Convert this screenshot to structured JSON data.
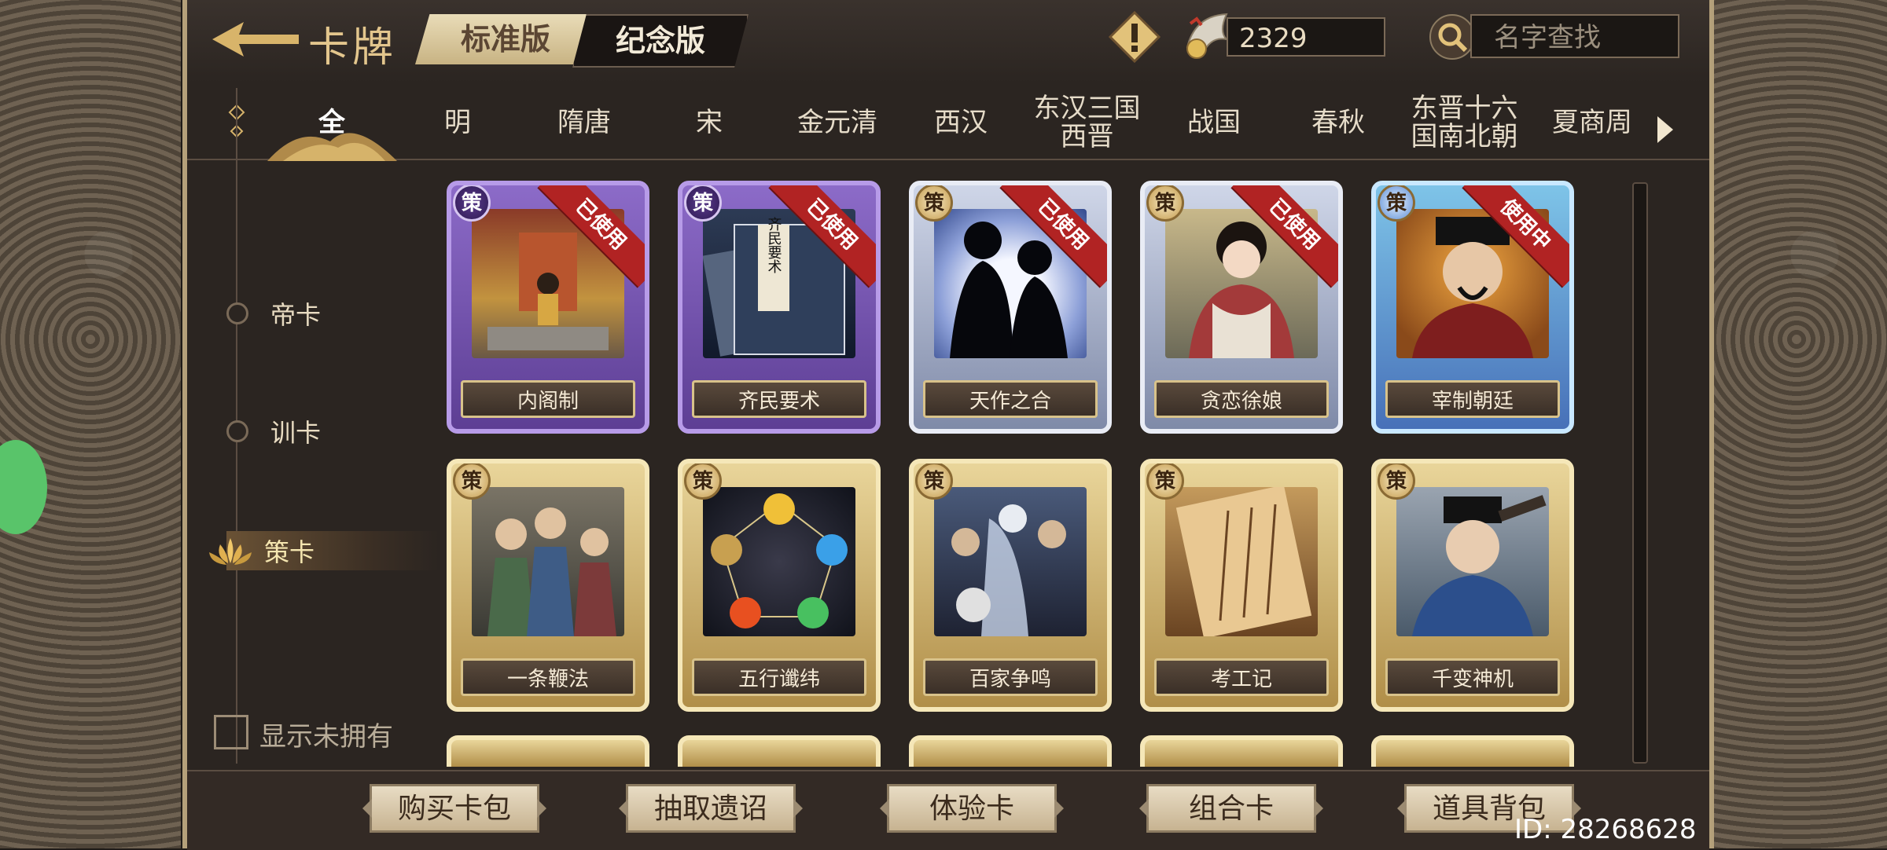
{
  "header": {
    "title": "卡牌",
    "version_tabs": [
      "标准版",
      "纪念版"
    ],
    "currency_value": "2329",
    "search_placeholder": "名字查找"
  },
  "era_tabs": [
    {
      "label": "全",
      "active": true
    },
    {
      "label": "明"
    },
    {
      "label": "隋唐"
    },
    {
      "label": "宋"
    },
    {
      "label": "金元清"
    },
    {
      "label": "西汉"
    },
    {
      "label": "东汉三国\n西晋"
    },
    {
      "label": "战国"
    },
    {
      "label": "春秋"
    },
    {
      "label": "东晋十六\n国南北朝"
    },
    {
      "label": "夏商周"
    }
  ],
  "categories": [
    {
      "label": "帝卡"
    },
    {
      "label": "训卡"
    },
    {
      "label": "策卡",
      "active": true
    }
  ],
  "show_unowned_label": "显示未拥有",
  "card_badge_text": "策",
  "cards_row1": [
    {
      "name": "内阁制",
      "status": "已使用",
      "frame": "purple"
    },
    {
      "name": "齐民要术",
      "status": "已使用",
      "frame": "purple"
    },
    {
      "name": "天作之合",
      "status": "已使用",
      "frame": "silver"
    },
    {
      "name": "贪恋徐娘",
      "status": "已使用",
      "frame": "silver"
    },
    {
      "name": "宰制朝廷",
      "status": "使用中",
      "frame": "blue"
    }
  ],
  "cards_row2": [
    {
      "name": "一条鞭法",
      "frame": "gold"
    },
    {
      "name": "五行谶纬",
      "frame": "gold"
    },
    {
      "name": "百家争鸣",
      "frame": "gold"
    },
    {
      "name": "考工记",
      "frame": "gold"
    },
    {
      "name": "千变神机",
      "frame": "gold"
    }
  ],
  "book_cover_text": "齐民要术",
  "bottom_buttons": [
    "购买卡包",
    "抽取遗诏",
    "体验卡",
    "组合卡",
    "道具背包"
  ],
  "user_id": "ID: 28268628",
  "colors": {
    "ribbon": "#b12323",
    "gold_text": "#e3c68d",
    "panel": "#2b2521"
  }
}
